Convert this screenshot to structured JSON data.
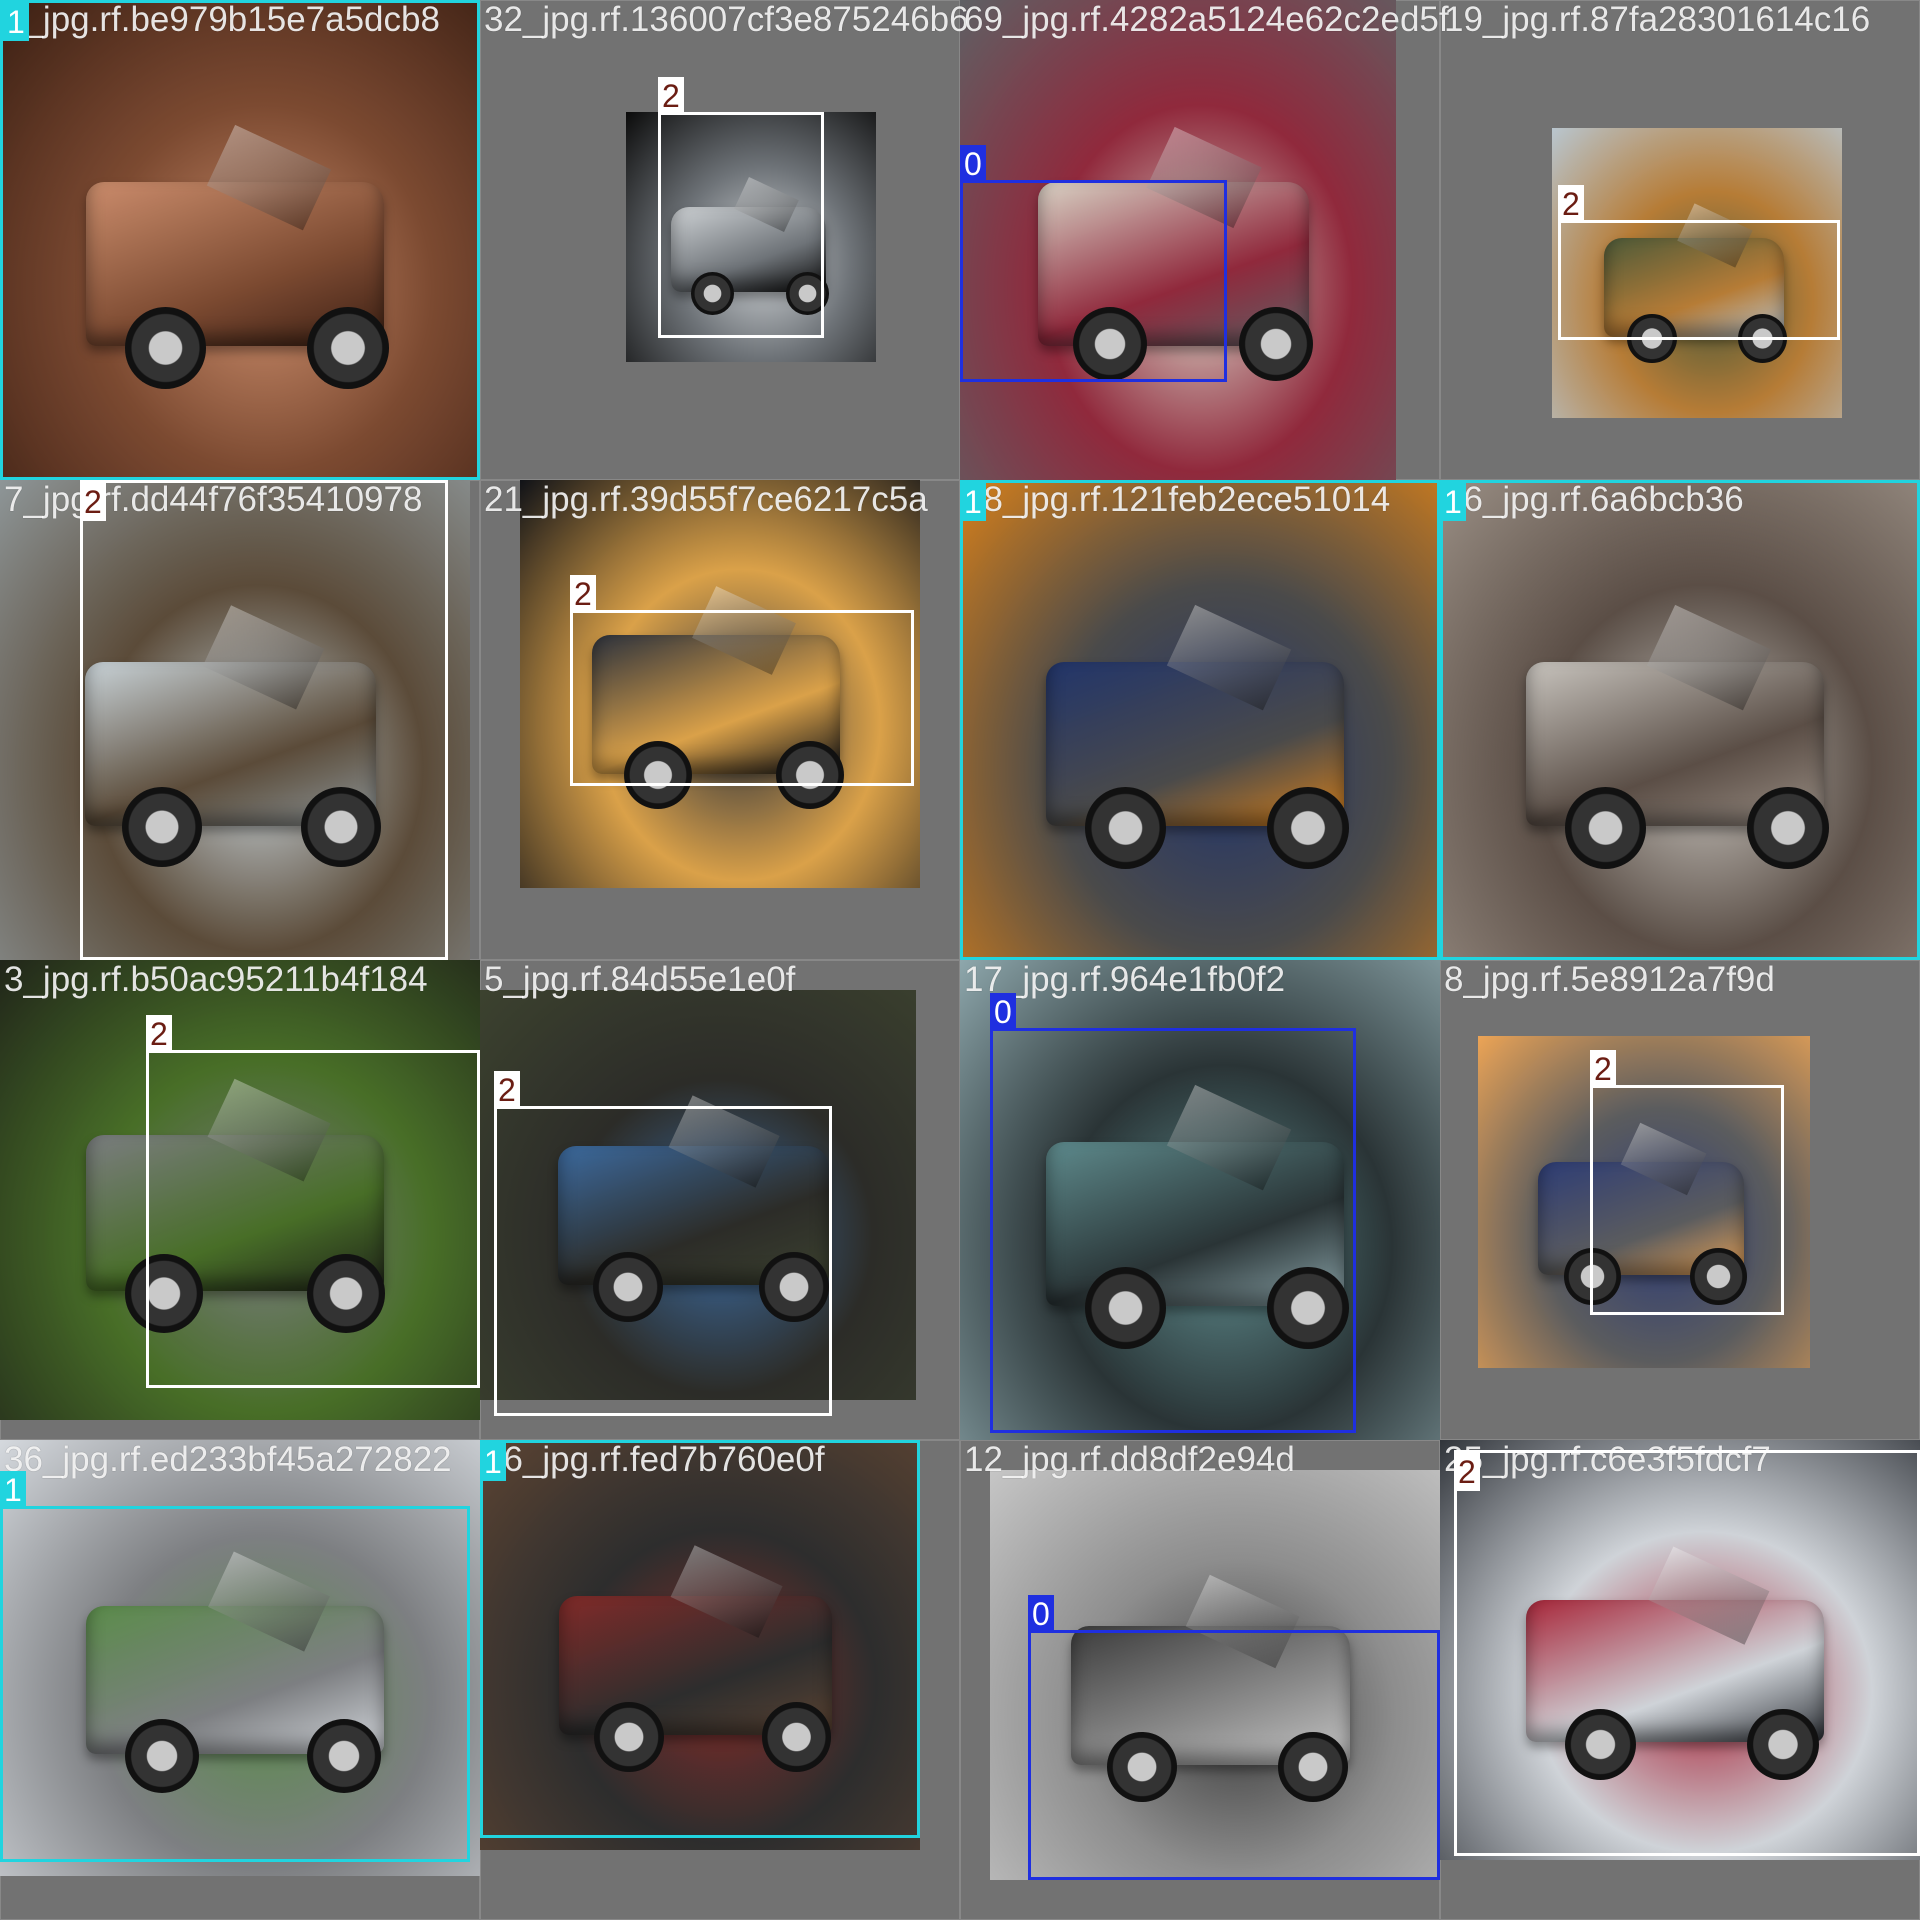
{
  "mosaic": {
    "class_styles": {
      "0": {
        "box_color": "#1f2fe0",
        "label_bg": "#1f2fe0",
        "label_fg": "#ffffff"
      },
      "1": {
        "box_color": "#21d4df",
        "label_bg": "#21d4df",
        "label_fg": "#ffffff"
      },
      "2": {
        "box_color": "#ffffff",
        "label_bg": "#ffffff",
        "label_fg": "#6b1d13"
      }
    },
    "tiles": [
      {
        "filename": "1_jpg.rf.be979b15e7a5dcb8",
        "palette": [
          "#3a1f14",
          "#c98d6e",
          "#7a4a33"
        ],
        "label": "1"
      },
      {
        "filename": "32_jpg.rf.136007cf3e875246b6",
        "palette": [
          "#0b0b0b",
          "#cfd3d6",
          "#6e7378"
        ],
        "label": "2"
      },
      {
        "filename": "69_jpg.rf.4282a5124e62c2ed5f",
        "palette": [
          "#5e6064",
          "#d8d2c6",
          "#8c2a3c"
        ],
        "label": "0"
      },
      {
        "filename": "19_jpg.rf.87fa28301614c16",
        "palette": [
          "#b9c6cf",
          "#4d5a3a",
          "#b47c3a"
        ],
        "label": "2"
      },
      {
        "filename": "7_jpg.rf.dd44f76f35410978",
        "palette": [
          "#8e9698",
          "#c9d3d8",
          "#5a4b3a"
        ],
        "label": "2"
      },
      {
        "filename": "21_jpg.rf.39d55f7ce6217c5a",
        "palette": [
          "#101217",
          "#2d323c",
          "#d8a14d"
        ],
        "label": "2"
      },
      {
        "filename": "28_jpg.rf.121feb2ece51014",
        "palette": [
          "#d4801f",
          "#233568",
          "#4a4a4a"
        ],
        "label": "1"
      },
      {
        "filename": "26_jpg.rf.6a6bcb36",
        "palette": [
          "#9a8f86",
          "#c8c4be",
          "#5a4e46"
        ],
        "label": "1"
      },
      {
        "filename": "3_jpg.rf.b50ac95211b4f184",
        "palette": [
          "#20251a",
          "#7a7d7f",
          "#496d2a"
        ],
        "label": "2"
      },
      {
        "filename": "5_jpg.rf.84d55e1e0f",
        "palette": [
          "#3c4230",
          "#3e6a9c",
          "#2c2c28"
        ],
        "label": "2"
      },
      {
        "filename": "17_jpg.rf.964e1fb0f2",
        "palette": [
          "#8fa7ac",
          "#5f8a8c",
          "#2a3436"
        ],
        "label": "0"
      },
      {
        "filename": "8_jpg.rf.5e8912a7f9d",
        "palette": [
          "#e9a45a",
          "#2f3d73",
          "#5b5c5e"
        ],
        "label": "2"
      },
      {
        "filename": "36_jpg.rf.ed233bf45a272822",
        "palette": [
          "#d5d9de",
          "#5c8b4d",
          "#7d7f82"
        ],
        "label": "1"
      },
      {
        "filename": "36_jpg.rf.fed7b760e0f",
        "palette": [
          "#5b4434",
          "#7e2c2a",
          "#2d2d2d"
        ],
        "label": "1"
      },
      {
        "filename": "12_jpg.rf.dd8df2e94d",
        "palette": [
          "#c6c6c6",
          "#3c3c3c",
          "#8d8d8d"
        ],
        "label": "0"
      },
      {
        "filename": "25_jpg.rf.c6e3f5fdcf7",
        "palette": [
          "#30343a",
          "#a3283a",
          "#cfd3d8"
        ],
        "label": "2"
      }
    ]
  }
}
